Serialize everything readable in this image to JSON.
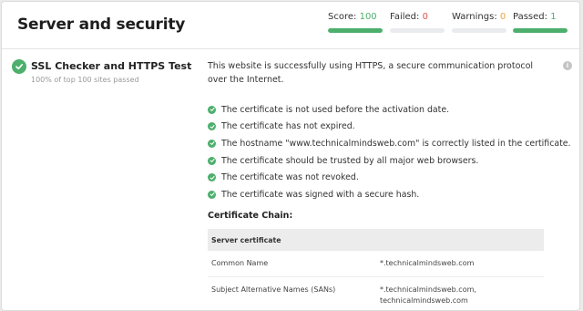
{
  "header": {
    "title": "Server and security"
  },
  "metrics": {
    "score": {
      "label": "Score:",
      "value": "100",
      "color": "#4caf6c",
      "fill": 1.0
    },
    "failed": {
      "label": "Failed:",
      "value": "0",
      "color": "#e05252",
      "fill": 0.0
    },
    "warnings": {
      "label": "Warnings:",
      "value": "0",
      "color": "#f0a23a",
      "fill": 0.0
    },
    "passed": {
      "label": "Passed:",
      "value": "1",
      "color": "#4caf6c",
      "fill": 1.0
    }
  },
  "check": {
    "title": "SSL Checker and HTTPS Test",
    "subtitle": "100% of top 100 sites passed",
    "status_icon": "check-circle-icon",
    "status_color": "#4caf6c",
    "summary": "This website is successfully using HTTPS, a secure communication protocol over the Internet.",
    "results": [
      "The certificate is not used before the activation date.",
      "The certificate has not expired.",
      "The hostname \"www.technicalmindsweb.com\" is correctly listed in the certificate.",
      "The certificate should be trusted by all major web browsers.",
      "The certificate was not revoked.",
      "The certificate was signed with a secure hash."
    ],
    "chain_heading": "Certificate Chain:",
    "chain_table": {
      "section": "Server certificate",
      "rows": [
        {
          "key": "Common Name",
          "value": "*.technicalmindsweb.com"
        },
        {
          "key": "Subject Alternative Names (SANs)",
          "value": "*.technicalmindsweb.com,\ntechnicalmindsweb.com"
        }
      ]
    }
  }
}
